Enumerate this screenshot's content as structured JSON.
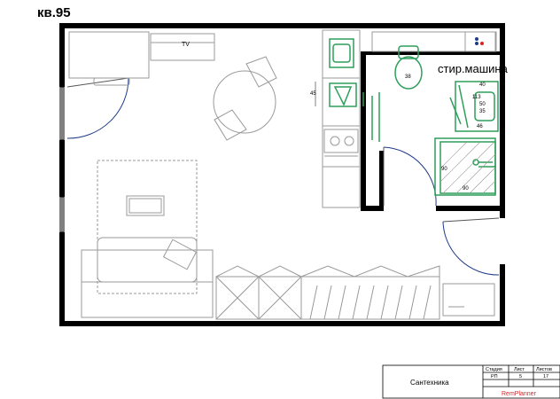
{
  "apartment_label": "кв.95",
  "plan": {
    "tv_label": "TV",
    "washer_label": "стир.машина",
    "toilet_dim": "38",
    "sink_dim": "45",
    "bath_dims": [
      "40",
      "113",
      "50",
      "35",
      "46"
    ],
    "shower_dims": [
      "90",
      "90"
    ]
  },
  "title_block": {
    "sheet_title": "Сантехника",
    "headers": [
      "Стадия",
      "Лист",
      "Листов"
    ],
    "values": [
      "РП",
      "5",
      "17"
    ],
    "brand": "RemPlanner",
    "brand_color": "#e02020"
  },
  "colors": {
    "wall": "#000000",
    "plumbing": "#2e9e5b",
    "furniture": "#9a9a9a",
    "door": "#1f3a8a"
  }
}
